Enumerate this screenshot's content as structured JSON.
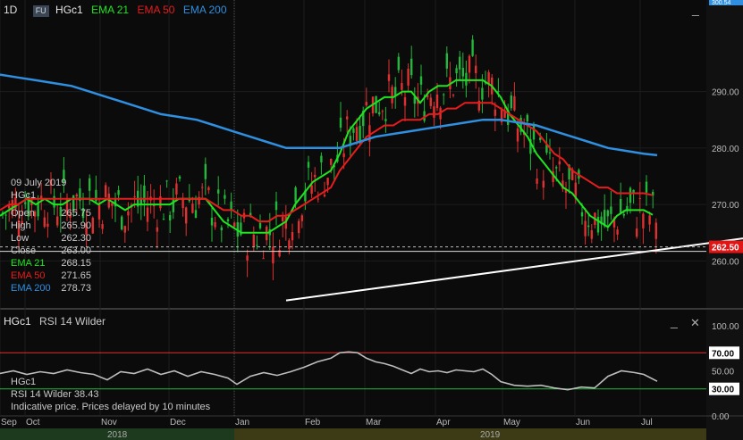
{
  "header": {
    "interval": "1D",
    "fu_badge": "FU",
    "symbol": "HGc1",
    "ema21_label": "EMA 21",
    "ema50_label": "EMA 50",
    "ema200_label": "EMA 200"
  },
  "rsi_header": {
    "symbol": "HGc1",
    "indicator": "RSI 14 Wilder"
  },
  "ohlc_panel": {
    "date": "09 July 2019",
    "symbol": "HGc1",
    "rows": [
      {
        "label": "Open",
        "value": "265.75"
      },
      {
        "label": "High",
        "value": "265.90"
      },
      {
        "label": "Low",
        "value": "262.30"
      },
      {
        "label": "Close",
        "value": "263.00"
      },
      {
        "label": "EMA 21",
        "value": "268.15"
      },
      {
        "label": "EMA 50",
        "value": "271.65"
      },
      {
        "label": "EMA 200",
        "value": "278.73"
      }
    ]
  },
  "rsi_panel": {
    "symbol": "HGc1",
    "reading": "RSI 14 Wilder 38.43",
    "note": "Indicative price. Prices delayed by 10 minutes"
  },
  "controls": {
    "minimize": "_",
    "close": "✕"
  },
  "colors": {
    "candle_up": "#22b83a",
    "candle_down": "#e03030",
    "ema21": "#1ee61e",
    "ema50": "#e81c1c",
    "ema200": "#2f8fe0",
    "rsi": "#bdbdbd",
    "trendline": "#ffffff",
    "price_badge": "#e01515"
  },
  "chart_data": {
    "type": "line",
    "symbol": "HGc1",
    "interval": "1D",
    "price_axis": {
      "ticks": [
        260,
        270,
        280,
        290
      ],
      "labels": [
        "260.00",
        "270.00",
        "280.00",
        "290.00"
      ],
      "ylim": [
        252,
        304
      ],
      "last_price_label": "262.50",
      "top_partial_label": "300.54"
    },
    "time_axis": {
      "month_labels": [
        "Sep",
        "Oct",
        "Nov",
        "Dec",
        "Jan",
        "Feb",
        "Mar",
        "Apr",
        "May",
        "Jun",
        "Jul"
      ],
      "year_labels": [
        "2018",
        "2019"
      ]
    },
    "series": [
      {
        "name": "EMA 21",
        "points": [
          [
            0,
            268
          ],
          [
            10,
            269
          ],
          [
            20,
            270
          ],
          [
            30,
            271
          ],
          [
            40,
            270
          ],
          [
            50,
            271
          ],
          [
            60,
            270
          ],
          [
            70,
            270
          ],
          [
            80,
            271
          ],
          [
            90,
            271
          ],
          [
            100,
            271
          ],
          [
            110,
            270
          ],
          [
            120,
            271
          ],
          [
            130,
            270
          ],
          [
            140,
            269
          ],
          [
            150,
            270
          ],
          [
            160,
            270
          ],
          [
            170,
            270
          ],
          [
            180,
            270
          ],
          [
            190,
            270
          ],
          [
            200,
            271
          ],
          [
            210,
            271
          ],
          [
            220,
            271
          ],
          [
            230,
            271
          ],
          [
            240,
            269
          ],
          [
            250,
            267
          ],
          [
            260,
            266
          ],
          [
            270,
            265
          ],
          [
            280,
            265
          ],
          [
            290,
            265
          ],
          [
            300,
            265
          ],
          [
            310,
            266
          ],
          [
            320,
            267
          ],
          [
            330,
            270
          ],
          [
            340,
            272
          ],
          [
            350,
            274
          ],
          [
            360,
            275
          ],
          [
            370,
            276
          ],
          [
            380,
            279
          ],
          [
            390,
            283
          ],
          [
            400,
            285
          ],
          [
            410,
            287
          ],
          [
            420,
            288
          ],
          [
            430,
            289
          ],
          [
            440,
            289
          ],
          [
            450,
            290
          ],
          [
            460,
            290
          ],
          [
            470,
            288
          ],
          [
            480,
            290
          ],
          [
            490,
            291
          ],
          [
            500,
            291
          ],
          [
            510,
            292
          ],
          [
            520,
            292
          ],
          [
            530,
            292
          ],
          [
            540,
            292
          ],
          [
            550,
            291
          ],
          [
            560,
            289
          ],
          [
            570,
            286
          ],
          [
            580,
            284
          ],
          [
            590,
            282
          ],
          [
            600,
            279
          ],
          [
            610,
            277
          ],
          [
            620,
            275
          ],
          [
            630,
            273
          ],
          [
            640,
            272
          ],
          [
            650,
            270
          ],
          [
            660,
            268
          ],
          [
            670,
            267
          ],
          [
            680,
            266
          ],
          [
            690,
            268
          ],
          [
            700,
            269
          ],
          [
            710,
            269
          ],
          [
            720,
            269
          ],
          [
            730,
            268.15
          ]
        ]
      },
      {
        "name": "EMA 50",
        "points": [
          [
            0,
            269
          ],
          [
            10,
            270
          ],
          [
            20,
            270
          ],
          [
            30,
            271
          ],
          [
            40,
            271
          ],
          [
            50,
            271
          ],
          [
            60,
            271
          ],
          [
            70,
            271
          ],
          [
            80,
            271
          ],
          [
            90,
            271
          ],
          [
            100,
            271
          ],
          [
            110,
            271
          ],
          [
            120,
            271
          ],
          [
            130,
            271
          ],
          [
            140,
            271
          ],
          [
            150,
            271
          ],
          [
            160,
            271
          ],
          [
            170,
            271
          ],
          [
            180,
            271
          ],
          [
            190,
            271
          ],
          [
            200,
            271
          ],
          [
            210,
            271
          ],
          [
            220,
            271
          ],
          [
            230,
            271
          ],
          [
            240,
            270
          ],
          [
            250,
            269
          ],
          [
            260,
            269
          ],
          [
            270,
            268
          ],
          [
            280,
            268
          ],
          [
            290,
            267
          ],
          [
            300,
            267
          ],
          [
            310,
            268
          ],
          [
            320,
            268
          ],
          [
            330,
            269
          ],
          [
            340,
            270
          ],
          [
            350,
            271
          ],
          [
            360,
            272
          ],
          [
            370,
            273
          ],
          [
            380,
            276
          ],
          [
            390,
            278
          ],
          [
            400,
            280
          ],
          [
            410,
            282
          ],
          [
            420,
            283
          ],
          [
            430,
            284
          ],
          [
            440,
            284
          ],
          [
            450,
            285
          ],
          [
            460,
            285
          ],
          [
            470,
            285
          ],
          [
            480,
            286
          ],
          [
            490,
            286
          ],
          [
            500,
            287
          ],
          [
            510,
            287
          ],
          [
            520,
            288
          ],
          [
            530,
            288
          ],
          [
            540,
            288
          ],
          [
            550,
            288
          ],
          [
            560,
            287
          ],
          [
            570,
            286
          ],
          [
            580,
            285
          ],
          [
            590,
            284
          ],
          [
            600,
            283
          ],
          [
            610,
            281
          ],
          [
            620,
            279
          ],
          [
            630,
            278
          ],
          [
            640,
            276
          ],
          [
            650,
            275
          ],
          [
            660,
            274
          ],
          [
            670,
            273
          ],
          [
            680,
            273
          ],
          [
            690,
            272
          ],
          [
            700,
            272
          ],
          [
            710,
            272
          ],
          [
            720,
            272
          ],
          [
            730,
            271.65
          ]
        ]
      },
      {
        "name": "EMA 200",
        "points": [
          [
            0,
            293
          ],
          [
            20,
            292.5
          ],
          [
            40,
            292
          ],
          [
            60,
            291.5
          ],
          [
            80,
            291
          ],
          [
            100,
            290
          ],
          [
            120,
            289
          ],
          [
            140,
            288
          ],
          [
            160,
            287
          ],
          [
            180,
            286
          ],
          [
            200,
            285.5
          ],
          [
            220,
            285
          ],
          [
            240,
            284
          ],
          [
            260,
            283
          ],
          [
            280,
            282
          ],
          [
            300,
            281
          ],
          [
            320,
            280
          ],
          [
            340,
            280
          ],
          [
            360,
            280
          ],
          [
            380,
            280
          ],
          [
            400,
            281
          ],
          [
            420,
            282
          ],
          [
            440,
            282.5
          ],
          [
            460,
            283
          ],
          [
            480,
            283.5
          ],
          [
            500,
            284
          ],
          [
            520,
            284.5
          ],
          [
            540,
            285
          ],
          [
            560,
            285
          ],
          [
            580,
            284.5
          ],
          [
            600,
            284
          ],
          [
            620,
            283
          ],
          [
            640,
            282
          ],
          [
            660,
            281
          ],
          [
            680,
            280
          ],
          [
            700,
            279.5
          ],
          [
            720,
            279
          ],
          [
            735,
            278.73
          ]
        ]
      }
    ],
    "trendline": {
      "from": [
        320,
        253
      ],
      "to": [
        831,
        264
      ]
    },
    "dashed_level": 262.5,
    "rsi": {
      "name": "RSI 14 Wilder",
      "ylim": [
        0,
        100
      ],
      "ticks": [
        0,
        30,
        50,
        70,
        100
      ],
      "tick_labels": [
        "0.00",
        "30.00",
        "50.00",
        "70.00",
        "100.00"
      ],
      "overbought": 70,
      "oversold": 30,
      "last": 38.43,
      "points": [
        [
          0,
          47
        ],
        [
          15,
          50
        ],
        [
          30,
          46
        ],
        [
          45,
          49
        ],
        [
          60,
          47
        ],
        [
          75,
          51
        ],
        [
          90,
          48
        ],
        [
          105,
          46
        ],
        [
          120,
          40
        ],
        [
          135,
          49
        ],
        [
          150,
          47
        ],
        [
          165,
          52
        ],
        [
          180,
          46
        ],
        [
          195,
          50
        ],
        [
          210,
          44
        ],
        [
          225,
          49
        ],
        [
          240,
          46
        ],
        [
          255,
          42
        ],
        [
          265,
          35
        ],
        [
          280,
          44
        ],
        [
          295,
          48
        ],
        [
          310,
          45
        ],
        [
          325,
          49
        ],
        [
          340,
          54
        ],
        [
          355,
          60
        ],
        [
          370,
          64
        ],
        [
          380,
          70
        ],
        [
          390,
          71
        ],
        [
          400,
          70
        ],
        [
          410,
          64
        ],
        [
          420,
          60
        ],
        [
          430,
          58
        ],
        [
          440,
          55
        ],
        [
          450,
          51
        ],
        [
          460,
          47
        ],
        [
          470,
          52
        ],
        [
          480,
          49
        ],
        [
          490,
          50
        ],
        [
          500,
          48
        ],
        [
          510,
          51
        ],
        [
          520,
          50
        ],
        [
          530,
          49
        ],
        [
          540,
          52
        ],
        [
          550,
          46
        ],
        [
          560,
          38
        ],
        [
          575,
          34
        ],
        [
          590,
          33
        ],
        [
          605,
          34
        ],
        [
          620,
          31
        ],
        [
          635,
          29
        ],
        [
          650,
          32
        ],
        [
          665,
          31
        ],
        [
          680,
          44
        ],
        [
          695,
          50
        ],
        [
          710,
          48
        ],
        [
          720,
          46
        ],
        [
          735,
          38.43
        ]
      ]
    }
  }
}
